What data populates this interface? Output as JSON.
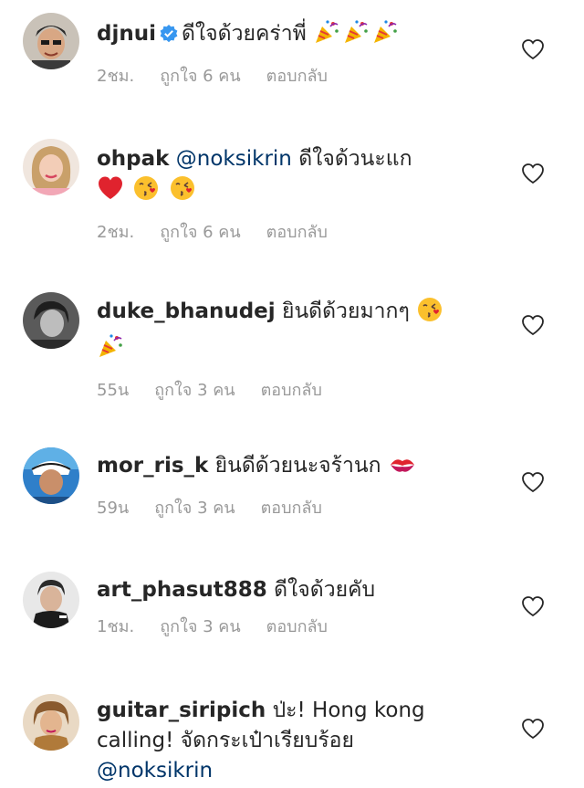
{
  "comments": [
    {
      "username": "djnui",
      "verified": true,
      "text": "ดีใจด้วยคร่าพี่",
      "emojis": [
        "party-popper",
        "party-popper",
        "party-popper"
      ],
      "time": "2ชม.",
      "likes": "ถูกใจ 6 คน",
      "reply": "ตอบกลับ"
    },
    {
      "username": "ohpak",
      "mention": "@noksikrin",
      "text": "ดีใจด้วนะแก",
      "emojis": [
        "red-heart",
        "kissing-face",
        "kissing-face"
      ],
      "time": "2ชม.",
      "likes": "ถูกใจ 6 คน",
      "reply": "ตอบกลับ"
    },
    {
      "username": "duke_bhanudej",
      "text": "ยินดีด้วยมากๆ",
      "emojis": [
        "kissing-face",
        "party-popper"
      ],
      "time": "55น",
      "likes": "ถูกใจ 3 คน",
      "reply": "ตอบกลับ"
    },
    {
      "username": "mor_ris_k",
      "text": "ยินดีด้วยนะจร้านก",
      "emojis": [
        "kiss-mark"
      ],
      "time": "59น",
      "likes": "ถูกใจ 3 คน",
      "reply": "ตอบกลับ"
    },
    {
      "username": "art_phasut888",
      "text": "ดีใจด้วยคับ",
      "time": "1ชม.",
      "likes": "ถูกใจ 3 คน",
      "reply": "ตอบกลับ"
    },
    {
      "username": "guitar_siripich",
      "text": "ป่ะ! Hong kong calling! จัดกระเป๋าเรียบร้อย",
      "mention": "@noksikrin"
    }
  ],
  "colors": {
    "text": "#262626",
    "meta": "#999999",
    "mention": "#003569",
    "verified": "#3897f0",
    "heart_outline": "#262626"
  },
  "icons": {
    "like": "heart-outline-icon",
    "verified": "verified-badge-icon"
  }
}
